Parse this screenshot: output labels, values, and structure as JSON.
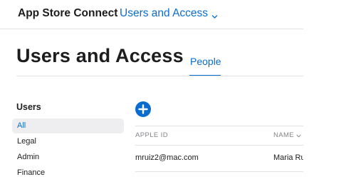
{
  "header": {
    "app_title": "App Store Connect",
    "section_menu_label": "Users and Access"
  },
  "page": {
    "title": "Users and Access",
    "tabs": [
      {
        "label": "People",
        "active": true
      }
    ]
  },
  "sidebar": {
    "heading": "Users",
    "items": [
      {
        "label": "All",
        "selected": true
      },
      {
        "label": "Legal",
        "selected": false
      },
      {
        "label": "Admin",
        "selected": false
      },
      {
        "label": "Finance",
        "selected": false
      }
    ]
  },
  "toolbar": {
    "add_icon": "plus-circle-icon"
  },
  "table": {
    "columns": [
      "APPLE ID",
      "NAME"
    ],
    "sort_indicator": "chevron-down-icon",
    "rows": [
      {
        "apple_id": "mruiz2@mac.com",
        "name": "Maria Ru"
      }
    ]
  },
  "colors": {
    "accent": "#0a6ccf",
    "text": "#1d1d1f",
    "muted": "#86868b",
    "divider": "#e3e3e6",
    "selected_bg": "#eeeef0"
  }
}
